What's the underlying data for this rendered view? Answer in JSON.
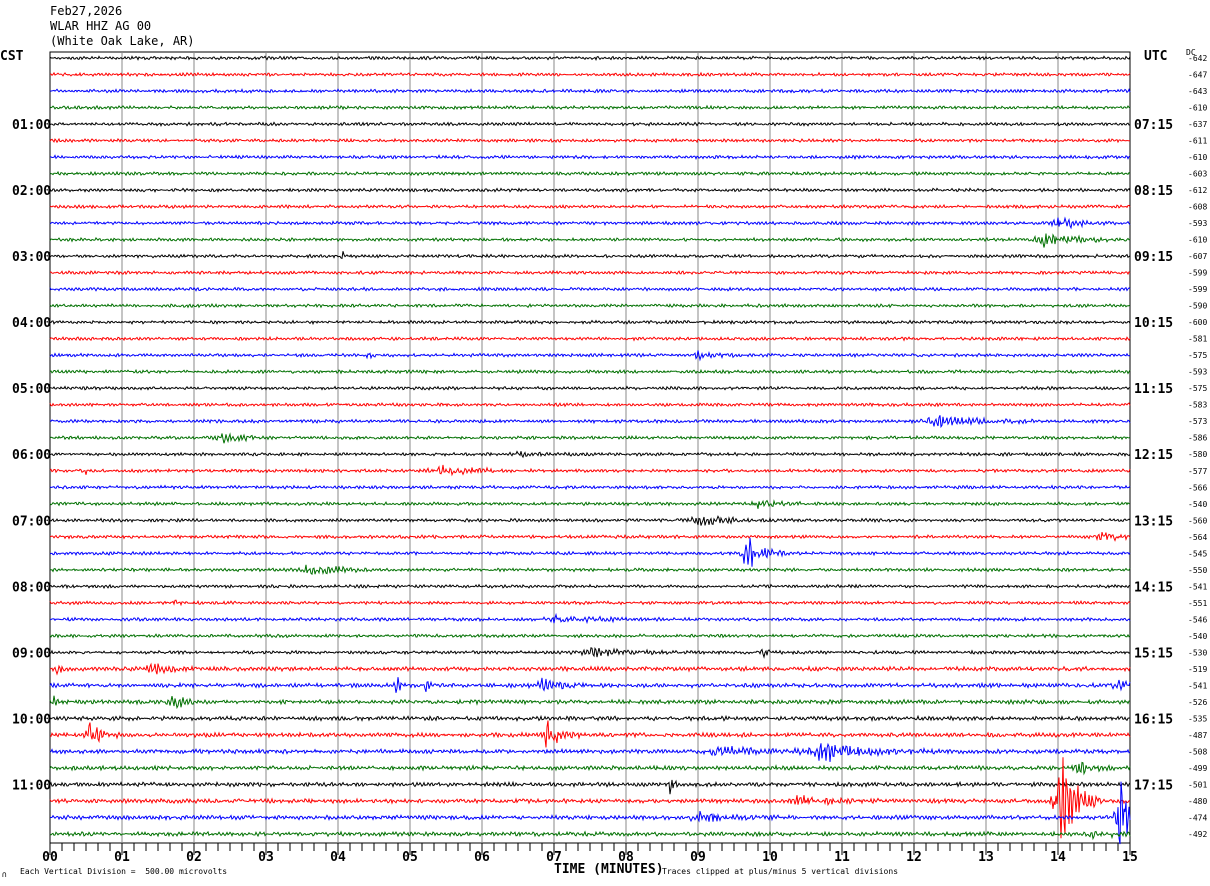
{
  "header": {
    "date": "Feb27,2026",
    "station": "WLAR HHZ AG 00",
    "location": "(White Oak Lake, AR)"
  },
  "left_tz": "CST",
  "right_tz": "UTC",
  "dc_label": "DC",
  "footer": {
    "scale": "Each Vertical Division =  500.00 microvolts",
    "xlabel": "TIME (MINUTES)",
    "clip_note": "Traces clipped at plus/minus 5 vertical divisions",
    "mark": "∩"
  },
  "chart_data": {
    "type": "line",
    "title": "WLAR HHZ AG 00 helicorder",
    "xlabel": "TIME (MINUTES)",
    "xlim": [
      0,
      15
    ],
    "x_ticks": [
      "00",
      "01",
      "02",
      "03",
      "04",
      "05",
      "06",
      "07",
      "08",
      "09",
      "10",
      "11",
      "12",
      "13",
      "14",
      "15"
    ],
    "colors": [
      "#000000",
      "#ff0000",
      "#0000ff",
      "#007000"
    ],
    "left_labels": [
      {
        "row": 4,
        "text": "01:00"
      },
      {
        "row": 8,
        "text": "02:00"
      },
      {
        "row": 12,
        "text": "03:00"
      },
      {
        "row": 16,
        "text": "04:00"
      },
      {
        "row": 20,
        "text": "05:00"
      },
      {
        "row": 24,
        "text": "06:00"
      },
      {
        "row": 28,
        "text": "07:00"
      },
      {
        "row": 32,
        "text": "08:00"
      },
      {
        "row": 36,
        "text": "09:00"
      },
      {
        "row": 40,
        "text": "10:00"
      },
      {
        "row": 44,
        "text": "11:00"
      }
    ],
    "right_labels": [
      {
        "row": 4,
        "text": "07:15"
      },
      {
        "row": 8,
        "text": "08:15"
      },
      {
        "row": 12,
        "text": "09:15"
      },
      {
        "row": 16,
        "text": "10:15"
      },
      {
        "row": 20,
        "text": "11:15"
      },
      {
        "row": 24,
        "text": "12:15"
      },
      {
        "row": 28,
        "text": "13:15"
      },
      {
        "row": 32,
        "text": "14:15"
      },
      {
        "row": 36,
        "text": "15:15"
      },
      {
        "row": 40,
        "text": "16:15"
      },
      {
        "row": 44,
        "text": "17:15"
      }
    ],
    "dc_offsets": [
      "-642",
      "-647",
      "-643",
      "-610",
      "-637",
      "-611",
      "-610",
      "-603",
      "-612",
      "-608",
      "-593",
      "-610",
      "-607",
      "-599",
      "-599",
      "-590",
      "-600",
      "-581",
      "-575",
      "-593",
      "-575",
      "-583",
      "-573",
      "-586",
      "-580",
      "-577",
      "-566",
      "-540",
      "-560",
      "-564",
      "-545",
      "-550",
      "-541",
      "-551",
      "-546",
      "-540",
      "-530",
      "-519",
      "-541",
      "-526",
      "-535",
      "-487",
      "-508",
      "-499",
      "-501",
      "-480",
      "-474",
      "-492"
    ],
    "events": [
      {
        "row": 10,
        "minute": 14.0,
        "amp": 6,
        "dur": 0.5
      },
      {
        "row": 11,
        "minute": 13.8,
        "amp": 5,
        "dur": 0.8
      },
      {
        "row": 12,
        "minute": 4.05,
        "amp": 4,
        "dur": 0.1
      },
      {
        "row": 18,
        "minute": 4.4,
        "amp": 3,
        "dur": 0.1
      },
      {
        "row": 18,
        "minute": 9.0,
        "amp": 3,
        "dur": 0.5
      },
      {
        "row": 22,
        "minute": 12.3,
        "amp": 5,
        "dur": 1.0
      },
      {
        "row": 23,
        "minute": 2.4,
        "amp": 4,
        "dur": 0.5
      },
      {
        "row": 24,
        "minute": 6.5,
        "amp": 2,
        "dur": 0.6
      },
      {
        "row": 25,
        "minute": 5.4,
        "amp": 4,
        "dur": 0.9
      },
      {
        "row": 25,
        "minute": 0.5,
        "amp": 3,
        "dur": 0.1
      },
      {
        "row": 27,
        "minute": 9.8,
        "amp": 4,
        "dur": 0.6
      },
      {
        "row": 28,
        "minute": 9.0,
        "amp": 4,
        "dur": 0.8
      },
      {
        "row": 29,
        "minute": 14.6,
        "amp": 3,
        "dur": 0.7
      },
      {
        "row": 30,
        "minute": 9.65,
        "amp": 16,
        "dur": 0.4
      },
      {
        "row": 31,
        "minute": 3.6,
        "amp": 6,
        "dur": 0.6
      },
      {
        "row": 33,
        "minute": 1.7,
        "amp": 3,
        "dur": 0.1
      },
      {
        "row": 34,
        "minute": 7.0,
        "amp": 3,
        "dur": 1.0
      },
      {
        "row": 36,
        "minute": 9.9,
        "amp": 6,
        "dur": 0.1
      },
      {
        "row": 36,
        "minute": 7.5,
        "amp": 3,
        "dur": 1.0
      },
      {
        "row": 37,
        "minute": 1.4,
        "amp": 5,
        "dur": 0.4
      },
      {
        "row": 37,
        "minute": 0.1,
        "amp": 5,
        "dur": 0.1
      },
      {
        "row": 38,
        "minute": 4.8,
        "amp": 10,
        "dur": 0.1
      },
      {
        "row": 38,
        "minute": 5.2,
        "amp": 8,
        "dur": 0.1
      },
      {
        "row": 38,
        "minute": 6.8,
        "amp": 5,
        "dur": 0.5
      },
      {
        "row": 38,
        "minute": 14.8,
        "amp": 4,
        "dur": 0.4
      },
      {
        "row": 39,
        "minute": 1.7,
        "amp": 6,
        "dur": 0.3
      },
      {
        "row": 39,
        "minute": 0.05,
        "amp": 5,
        "dur": 0.1
      },
      {
        "row": 41,
        "minute": 0.55,
        "amp": 10,
        "dur": 0.3
      },
      {
        "row": 41,
        "minute": 6.9,
        "amp": 14,
        "dur": 0.3
      },
      {
        "row": 42,
        "minute": 10.7,
        "amp": 8,
        "dur": 1.2
      },
      {
        "row": 42,
        "minute": 9.3,
        "amp": 4,
        "dur": 1.0
      },
      {
        "row": 43,
        "minute": 14.3,
        "amp": 6,
        "dur": 0.4
      },
      {
        "row": 44,
        "minute": 8.6,
        "amp": 10,
        "dur": 0.1
      },
      {
        "row": 45,
        "minute": 14.0,
        "amp": 50,
        "dur": 0.4
      },
      {
        "row": 45,
        "minute": 10.4,
        "amp": 4,
        "dur": 0.8
      },
      {
        "row": 46,
        "minute": 14.85,
        "amp": 40,
        "dur": 0.3
      },
      {
        "row": 46,
        "minute": 9.0,
        "amp": 4,
        "dur": 0.8
      },
      {
        "row": 47,
        "minute": 14.5,
        "amp": 3,
        "dur": 0.6
      }
    ]
  }
}
